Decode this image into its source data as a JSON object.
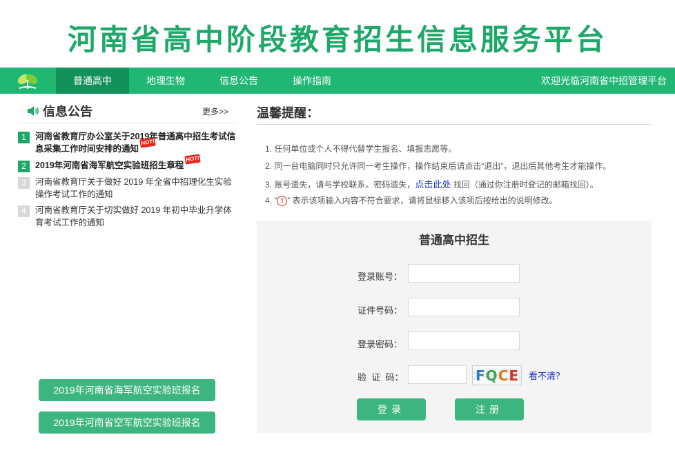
{
  "header": {
    "site_title": "河南省高中阶段教育招生信息服务平台"
  },
  "nav": {
    "items": [
      {
        "label": "普通高中",
        "active": true
      },
      {
        "label": "地理生物",
        "active": false
      },
      {
        "label": "信息公告",
        "active": false
      },
      {
        "label": "操作指南",
        "active": false
      }
    ],
    "welcome": "欢迎光临河南省中招管理平台",
    "logo_icon": "leaf-logo-icon"
  },
  "notices": {
    "title": "信息公告",
    "more": "更多>>",
    "items": [
      {
        "num": "1",
        "text": "河南省教育厅办公室关于2019年普通高中招生考试信息采集工作时间安排的通知",
        "bold": true,
        "hot": true,
        "hot_label": "HOT!"
      },
      {
        "num": "2",
        "text": "2019年河南省海军航空实验班招生章程",
        "bold": true,
        "hot": true,
        "hot_label": "HOT!"
      },
      {
        "num": "3",
        "text": "河南省教育厅关于做好 2019 年全省中招理化生实验操作考试工作的通知",
        "bold": false,
        "hot": false
      },
      {
        "num": "4",
        "text": "河南省教育厅关于切实做好 2019 年初中毕业升学体育考试工作的通知",
        "bold": false,
        "hot": false
      }
    ]
  },
  "side_buttons": [
    "2019年河南省海军航空实验班报名",
    "2019年河南省空军航空实验班报名"
  ],
  "tips": {
    "title": "温馨提醒：",
    "items": {
      "t1": "1.  任何单位或个人不得代替学生报名、填报志愿等。",
      "t2": "2.  同一台电脑同时只允许同一考生操作，操作结束后请点击“退出”，退出后其他考生才能操作。",
      "t3_before": "3.  账号遗失，请与学校联系。密码遗失，",
      "t3_link": "点击此处",
      "t3_after": " 找回（通过你注册时登记的邮箱找回）。",
      "t4_before": "4.   “",
      "t4_icon_glyph": "!",
      "t4_after": "” 表示该项输入内容不符合要求，请将鼠标移入该项后按给出的说明修改。"
    }
  },
  "login": {
    "title": "普通高中招生",
    "account_label": "登录账号：",
    "id_label": "证件号码：",
    "password_label": "登录密码：",
    "captcha_label": "验  证  码：",
    "captcha_text": "FQCE",
    "refresh": "看不清？",
    "login_button": "登录",
    "register_button": "注册",
    "account_value": "",
    "id_value": "",
    "password_value": "",
    "captcha_value": ""
  },
  "colors": {
    "brand_green": "#20b773",
    "nav_active": "#12915a",
    "button_green": "#3db57e",
    "link_blue": "#1733b8",
    "hot_red": "#e8261c"
  }
}
